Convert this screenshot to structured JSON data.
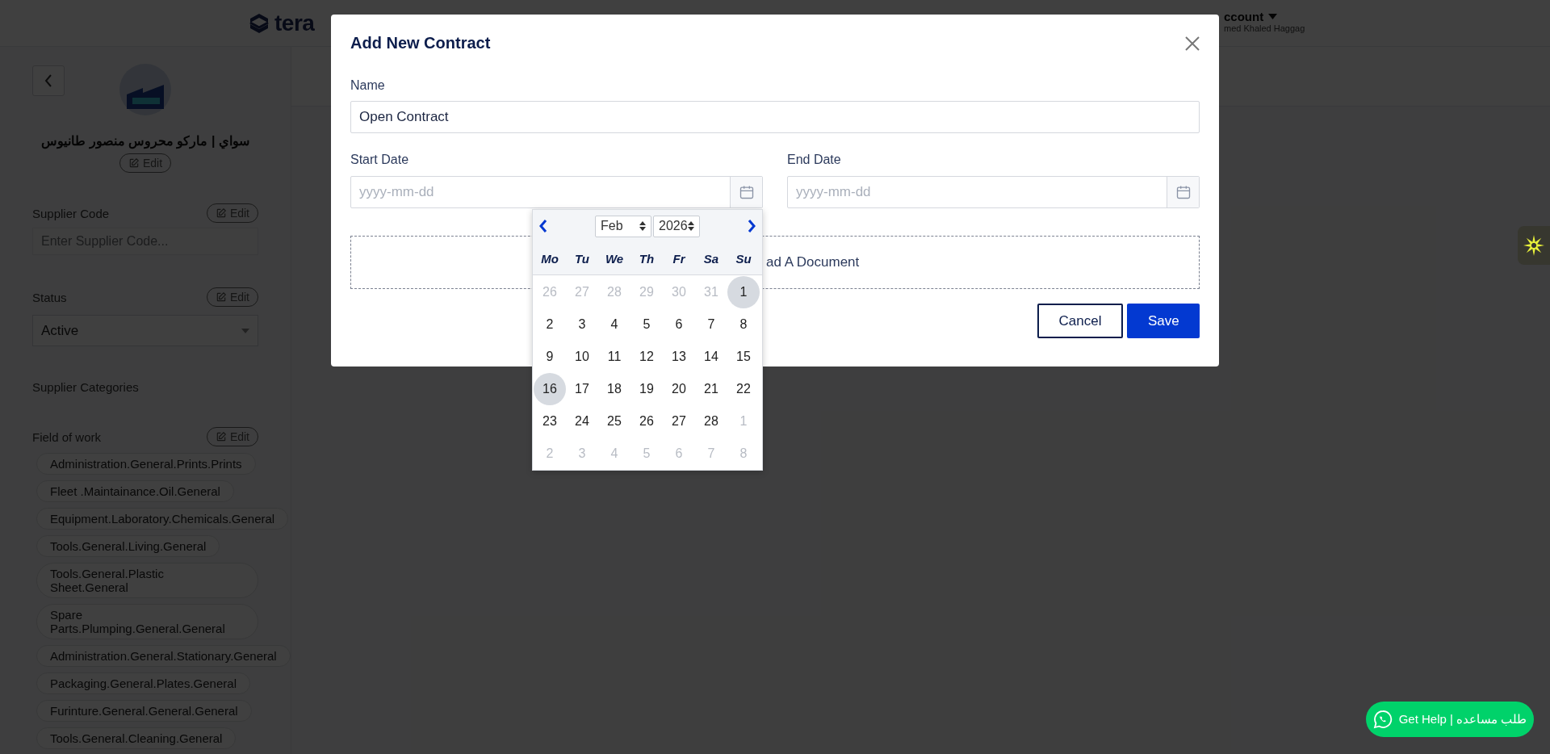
{
  "header": {
    "logo_text": "tera",
    "account_label": "ccount",
    "user_name": "med Khaled Haggag"
  },
  "sidebar": {
    "supplier_name": "سواي | ماركو محروس منصور طانيوس",
    "name_edit": "Edit",
    "sections": [
      {
        "kind": "input",
        "label": "Supplier Code",
        "edit": "Edit",
        "placeholder": "Enter Supplier Code..."
      },
      {
        "kind": "select",
        "label": "Status",
        "edit": "Edit",
        "value": "Active"
      },
      {
        "kind": "heading",
        "label": "Supplier Categories"
      },
      {
        "kind": "tags",
        "label": "Field of work",
        "edit": "Edit",
        "tags": [
          "Administration.General.Prints.Prints",
          "Fleet .Maintainance.Oil.General",
          "Equipment.Laboratory.Chemicals.General",
          "Tools.General.Living.General",
          "Tools.General.Plastic Sheet.General",
          "Spare Parts.Plumping.General.General",
          "Administration.General.Stationary.General",
          "Packaging.General.Plates.General",
          "Furinture.General.General.General",
          "Tools.General.Cleaning.General"
        ]
      }
    ]
  },
  "modal": {
    "title": "Add New Contract",
    "name_label": "Name",
    "name_value": "Open Contract",
    "start_label": "Start Date",
    "start_placeholder": "yyyy-mm-dd",
    "end_label": "End Date",
    "end_placeholder": "yyyy-mm-dd",
    "upload_text": "ad A Document",
    "buttons": [
      {
        "label": "Cancel",
        "kind": "secondary"
      },
      {
        "label": "Save",
        "kind": "primary"
      }
    ]
  },
  "datepicker": {
    "month": "Feb",
    "year": "2026",
    "weekdays": [
      "Mo",
      "Tu",
      "We",
      "Th",
      "Fr",
      "Sa",
      "Su"
    ],
    "weeks": [
      [
        {
          "day": "26",
          "muted": true,
          "highlighted": false
        },
        {
          "day": "27",
          "muted": true,
          "highlighted": false
        },
        {
          "day": "28",
          "muted": true,
          "highlighted": false
        },
        {
          "day": "29",
          "muted": true,
          "highlighted": false
        },
        {
          "day": "30",
          "muted": true,
          "highlighted": false
        },
        {
          "day": "31",
          "muted": true,
          "highlighted": false
        },
        {
          "day": "1",
          "muted": false,
          "highlighted": true
        }
      ],
      [
        {
          "day": "2",
          "muted": false,
          "highlighted": false
        },
        {
          "day": "3",
          "muted": false,
          "highlighted": false
        },
        {
          "day": "4",
          "muted": false,
          "highlighted": false
        },
        {
          "day": "5",
          "muted": false,
          "highlighted": false
        },
        {
          "day": "6",
          "muted": false,
          "highlighted": false
        },
        {
          "day": "7",
          "muted": false,
          "highlighted": false
        },
        {
          "day": "8",
          "muted": false,
          "highlighted": false
        }
      ],
      [
        {
          "day": "9",
          "muted": false,
          "highlighted": false
        },
        {
          "day": "10",
          "muted": false,
          "highlighted": false
        },
        {
          "day": "11",
          "muted": false,
          "highlighted": false
        },
        {
          "day": "12",
          "muted": false,
          "highlighted": false
        },
        {
          "day": "13",
          "muted": false,
          "highlighted": false
        },
        {
          "day": "14",
          "muted": false,
          "highlighted": false
        },
        {
          "day": "15",
          "muted": false,
          "highlighted": false
        }
      ],
      [
        {
          "day": "16",
          "muted": false,
          "highlighted": true
        },
        {
          "day": "17",
          "muted": false,
          "highlighted": false
        },
        {
          "day": "18",
          "muted": false,
          "highlighted": false
        },
        {
          "day": "19",
          "muted": false,
          "highlighted": false
        },
        {
          "day": "20",
          "muted": false,
          "highlighted": false
        },
        {
          "day": "21",
          "muted": false,
          "highlighted": false
        },
        {
          "day": "22",
          "muted": false,
          "highlighted": false
        }
      ],
      [
        {
          "day": "23",
          "muted": false,
          "highlighted": false
        },
        {
          "day": "24",
          "muted": false,
          "highlighted": false
        },
        {
          "day": "25",
          "muted": false,
          "highlighted": false
        },
        {
          "day": "26",
          "muted": false,
          "highlighted": false
        },
        {
          "day": "27",
          "muted": false,
          "highlighted": false
        },
        {
          "day": "28",
          "muted": false,
          "highlighted": false
        },
        {
          "day": "1",
          "muted": true,
          "highlighted": false
        }
      ],
      [
        {
          "day": "2",
          "muted": true,
          "highlighted": false
        },
        {
          "day": "3",
          "muted": true,
          "highlighted": false
        },
        {
          "day": "4",
          "muted": true,
          "highlighted": false
        },
        {
          "day": "5",
          "muted": true,
          "highlighted": false
        },
        {
          "day": "6",
          "muted": true,
          "highlighted": false
        },
        {
          "day": "7",
          "muted": true,
          "highlighted": false
        },
        {
          "day": "8",
          "muted": true,
          "highlighted": false
        }
      ]
    ]
  },
  "help_button": {
    "label": "Get Help | طلب مساعده"
  }
}
